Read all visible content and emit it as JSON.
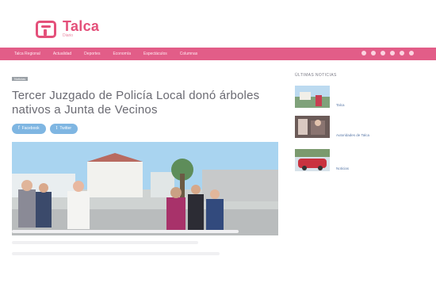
{
  "site": {
    "logo_title": "Talca",
    "logo_subtitle": "Diario"
  },
  "nav": {
    "items": [
      "Talca Regional",
      "Actualidad",
      "Deportes",
      "Economía",
      "Espectáculos",
      "Columnas"
    ],
    "social": [
      "facebook-icon",
      "twitter-icon",
      "instagram-icon",
      "youtube-icon",
      "rss-icon",
      "search-icon"
    ]
  },
  "article": {
    "category": "Noticias",
    "title": "Tercer Juzgado de Policía Local donó árboles nativos a Junta de Vecinos",
    "share": [
      {
        "icon": "f",
        "label": "Facebook"
      },
      {
        "icon": "t",
        "label": "Twitter"
      }
    ]
  },
  "sidebar": {
    "heading": "ÚLTIMAS NOTICIAS",
    "items": [
      {
        "caption": "Talca"
      },
      {
        "caption": "Autoridades de Talca"
      },
      {
        "caption": "Noticias"
      }
    ]
  },
  "colors": {
    "brand": "#e4507a",
    "nav": "#e25d88",
    "share": "#7fb6e2"
  }
}
